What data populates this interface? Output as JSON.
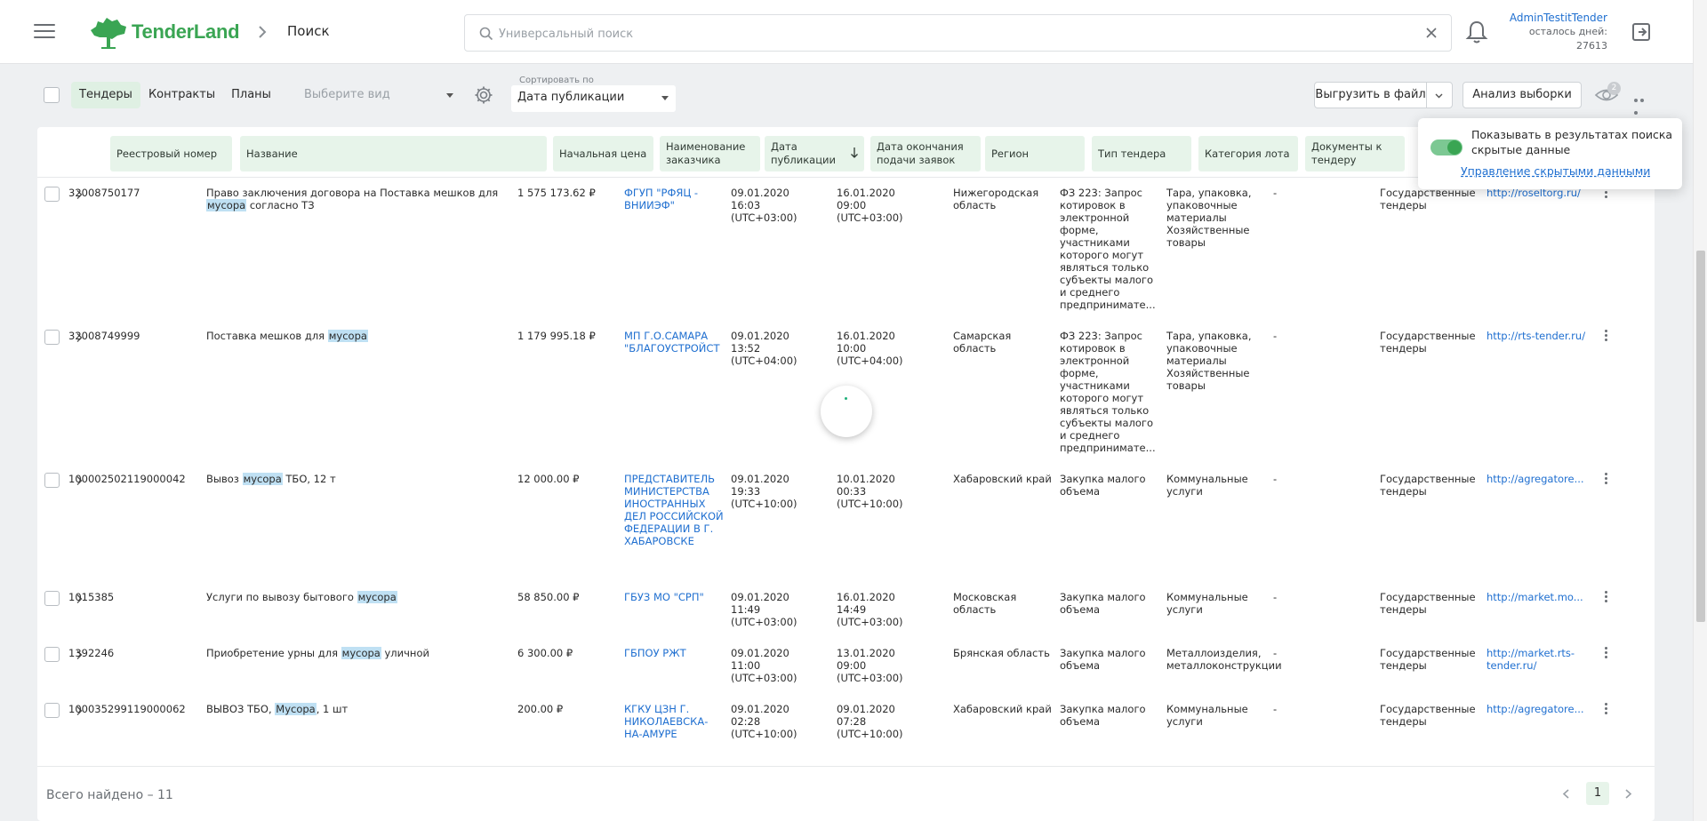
{
  "header": {
    "logo_text": "TenderLand",
    "breadcrumb": "Поиск",
    "search_placeholder": "Универсальный поиск",
    "user_name": "AdminTestitTender",
    "days_left_label": "осталось дней:",
    "days_left_value": "27613"
  },
  "toolbar": {
    "tabs": [
      "Тендеры",
      "Контракты",
      "Планы"
    ],
    "active_tab": "Тендеры",
    "view_placeholder": "Выберите вид",
    "sort_label": "Сортировать по",
    "sort_value": "Дата публикации",
    "export_label": "Выгрузить в файл",
    "analysis_label": "Анализ выборки",
    "hidden_count": "2"
  },
  "popover": {
    "text": "Показывать в результатах поиска скрытые данные",
    "link": "Управление скрытыми данными",
    "toggle_on": true
  },
  "table": {
    "columns": [
      "Реестровый номер",
      "Название",
      "Начальная цена",
      "Наименование заказчика",
      "Дата публикации",
      "Дата окончания подачи заявок",
      "Регион",
      "Тип тендера",
      "Категория лота",
      "Документы к тендеру"
    ],
    "rows": [
      {
        "number": "32008750177",
        "name_before": "Право заключения договора на Поставка мешков для ",
        "name_mark": "мусора",
        "name_after": " согласно ТЗ",
        "price": "1 575 173.62 ₽",
        "customer": "ФГУП \"РФЯЦ - ВНИИЭФ\"",
        "pub_date": "09.01.2020 16:03 (UTC+03:00)",
        "end_date": "16.01.2020 09:00 (UTC+03:00)",
        "region": "Нижегородская область",
        "type": "ФЗ 223: Запрос котировок в электронной форме, участниками которого могут являться только субъекты малого и среднего предпринимате...",
        "category": "Тара, упаковка, упаковочные материалы Хозяйственные товары",
        "docs": "-",
        "kind": "Государственные тендеры",
        "site": "http://roseltorg.ru/"
      },
      {
        "number": "32008749999",
        "name_before": "Поставка мешков для ",
        "name_mark": "мусора",
        "name_after": "",
        "price": "1 179 995.18 ₽",
        "customer": "МП Г.О.САМАРА \"БЛАГОУСТРОЙСТ",
        "pub_date": "09.01.2020 13:52 (UTC+04:00)",
        "end_date": "16.01.2020 10:00 (UTC+04:00)",
        "region": "Самарская область",
        "type": "ФЗ 223: Запрос котировок в электронной форме, участниками которого могут являться только субъекты малого и среднего предпринимате...",
        "category": "Тара, упаковка, упаковочные материалы Хозяйственные товары",
        "docs": "-",
        "kind": "Государственные тендеры",
        "site": "http://rts-tender.ru/"
      },
      {
        "number": "100002502119000042",
        "name_before": "Вывоз ",
        "name_mark": "мусора",
        "name_after": " ТБО, 12 т",
        "price": "12 000.00 ₽",
        "customer": "ПРЕДСТАВИТЕЛЬ МИНИСТЕРСТВА ИНОСТРАННЫХ ДЕЛ РОССИЙСКОЙ ФЕДЕРАЦИИ В Г. ХАБАРОВСКЕ",
        "pub_date": "09.01.2020 19:33 (UTC+10:00)",
        "end_date": "10.01.2020 00:33 (UTC+10:00)",
        "region": "Хабаровский край",
        "type": "Закупка малого объема",
        "category": "Коммунальные услуги",
        "docs": "-",
        "kind": "Государственные тендеры",
        "site": "http://agregatore..."
      },
      {
        "number": "1015385",
        "name_before": "Услуги по вывозу бытового ",
        "name_mark": "мусора",
        "name_after": "",
        "price": "58 850.00 ₽",
        "customer": "ГБУЗ МО \"СРП\"",
        "pub_date": "09.01.2020 11:49 (UTC+03:00)",
        "end_date": "16.01.2020 14:49 (UTC+03:00)",
        "region": "Московская область",
        "type": "Закупка малого объема",
        "category": "Коммунальные услуги",
        "docs": "-",
        "kind": "Государственные тендеры",
        "site": "http://market.mo..."
      },
      {
        "number": "1392246",
        "name_before": "Приобретение урны для ",
        "name_mark": "мусора",
        "name_after": " уличной",
        "price": "6 300.00 ₽",
        "customer": "ГБПОУ РЖТ",
        "pub_date": "09.01.2020 11:00 (UTC+03:00)",
        "end_date": "13.01.2020 09:00 (UTC+03:00)",
        "region": "Брянская область",
        "type": "Закупка малого объема",
        "category": "Металлоизделия, металлоконструкции",
        "docs": "-",
        "kind": "Государственные тендеры",
        "site": "http://market.rts-tender.ru/"
      },
      {
        "number": "100035299119000062",
        "name_before": "ВЫВОЗ ТБО, ",
        "name_mark": "Мусора",
        "name_after": ", 1 шт",
        "price": "200.00 ₽",
        "customer": "КГКУ ЦЗН Г. НИКОЛАЕВСКА-НА-АМУРЕ",
        "pub_date": "09.01.2020 02:28 (UTC+10:00)",
        "end_date": "09.01.2020 07:28 (UTC+10:00)",
        "region": "Хабаровский край",
        "type": "Закупка малого объема",
        "category": "Коммунальные услуги",
        "docs": "-",
        "kind": "Государственные тендеры",
        "site": "http://agregatore..."
      }
    ]
  },
  "footer": {
    "total": "Всего найдено – 11",
    "page": "1"
  },
  "colors": {
    "brand_green": "#3aa553",
    "header_cell_bg": "#e7f4ea",
    "link_blue": "#1f6fd0",
    "highlight": "#bfe0f3"
  }
}
